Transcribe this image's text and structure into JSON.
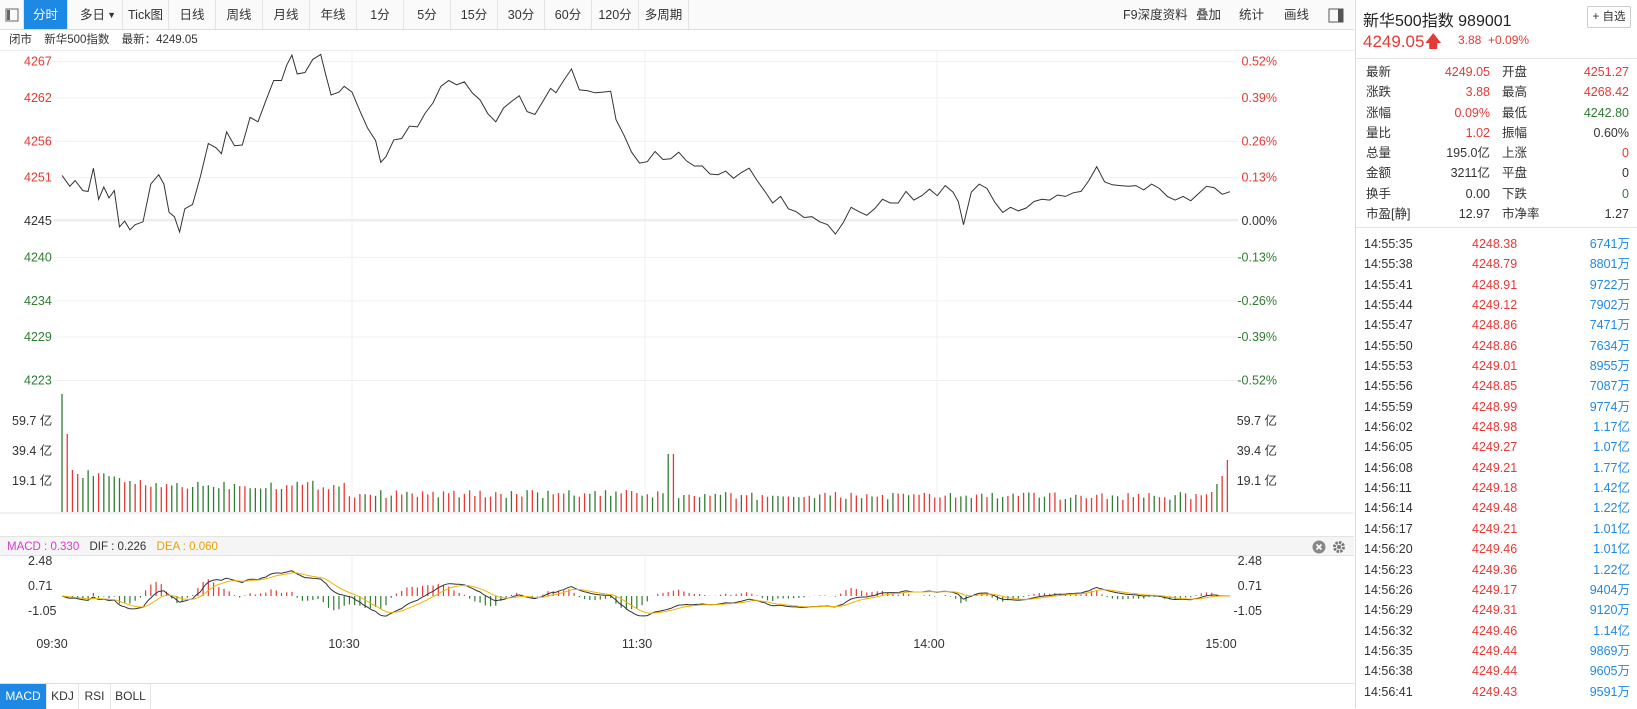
{
  "toolbar": {
    "tabs": [
      "分时",
      "多日",
      "Tick图",
      "日线",
      "周线",
      "月线",
      "年线",
      "1分",
      "5分",
      "15分",
      "30分",
      "60分",
      "120分",
      "多周期"
    ],
    "active_tab": "分时",
    "right_items": [
      "F9深度资料",
      "叠加",
      "统计",
      "画线"
    ]
  },
  "status": {
    "state": "闭市",
    "name": "新华500指数",
    "latest": "最新：4249.05"
  },
  "macd_info": {
    "macd": "MACD : 0.330",
    "dif": "DIF : 0.226",
    "dea": "DEA : 0.060"
  },
  "bottom_tabs": [
    "MACD",
    "KDJ",
    "RSI",
    "BOLL"
  ],
  "sidebar": {
    "title": "新华500指数  989001",
    "add_button": "+ 自选",
    "price": "4249.05",
    "change": "3.88",
    "change_pct": "+0.09%",
    "stats": [
      {
        "l": "最新",
        "v": "4249.05",
        "c": "red",
        "l2": "开盘",
        "v2": "4251.27",
        "c2": "red"
      },
      {
        "l": "涨跌",
        "v": "3.88",
        "c": "red",
        "l2": "最高",
        "v2": "4268.42",
        "c2": "red"
      },
      {
        "l": "涨幅",
        "v": "0.09%",
        "c": "red",
        "l2": "最低",
        "v2": "4242.80",
        "c2": "green"
      },
      {
        "l": "量比",
        "v": "1.02",
        "c": "red",
        "l2": "振幅",
        "v2": "0.60%",
        "c2": "dark"
      },
      {
        "l": "总量",
        "v": "195.0亿",
        "c": "dark",
        "l2": "上涨",
        "v2": "0",
        "c2": "red"
      },
      {
        "l": "金额",
        "v": "3211亿",
        "c": "dark",
        "l2": "平盘",
        "v2": "0",
        "c2": "dark"
      },
      {
        "l": "换手",
        "v": "0.00",
        "c": "dark",
        "l2": "下跌",
        "v2": "0",
        "c2": "green"
      },
      {
        "l": "市盈[静]",
        "v": "12.97",
        "c": "dark",
        "l2": "市净率",
        "v2": "1.27",
        "c2": "dark"
      }
    ],
    "ticks": [
      {
        "t": "14:55:35",
        "p": "4248.38",
        "v": "6741万"
      },
      {
        "t": "14:55:38",
        "p": "4248.79",
        "v": "8801万"
      },
      {
        "t": "14:55:41",
        "p": "4248.91",
        "v": "9722万"
      },
      {
        "t": "14:55:44",
        "p": "4249.12",
        "v": "7902万"
      },
      {
        "t": "14:55:47",
        "p": "4248.86",
        "v": "7471万"
      },
      {
        "t": "14:55:50",
        "p": "4248.86",
        "v": "7634万"
      },
      {
        "t": "14:55:53",
        "p": "4249.01",
        "v": "8955万"
      },
      {
        "t": "14:55:56",
        "p": "4248.85",
        "v": "7087万"
      },
      {
        "t": "14:55:59",
        "p": "4248.99",
        "v": "9774万"
      },
      {
        "t": "14:56:02",
        "p": "4248.98",
        "v": "1.17亿"
      },
      {
        "t": "14:56:05",
        "p": "4249.27",
        "v": "1.07亿"
      },
      {
        "t": "14:56:08",
        "p": "4249.21",
        "v": "1.77亿"
      },
      {
        "t": "14:56:11",
        "p": "4249.18",
        "v": "1.42亿"
      },
      {
        "t": "14:56:14",
        "p": "4249.48",
        "v": "1.22亿"
      },
      {
        "t": "14:56:17",
        "p": "4249.21",
        "v": "1.01亿"
      },
      {
        "t": "14:56:20",
        "p": "4249.46",
        "v": "1.01亿"
      },
      {
        "t": "14:56:23",
        "p": "4249.36",
        "v": "1.22亿"
      },
      {
        "t": "14:56:26",
        "p": "4249.17",
        "v": "9404万"
      },
      {
        "t": "14:56:29",
        "p": "4249.31",
        "v": "9120万"
      },
      {
        "t": "14:56:32",
        "p": "4249.46",
        "v": "1.14亿"
      },
      {
        "t": "14:56:35",
        "p": "4249.44",
        "v": "9869万"
      },
      {
        "t": "14:56:38",
        "p": "4249.44",
        "v": "9605万"
      },
      {
        "t": "14:56:41",
        "p": "4249.43",
        "v": "9591万"
      }
    ]
  },
  "colors": {
    "up": "#e53935",
    "down": "#2e7d32",
    "accent": "#1e88e5",
    "price_line": "#333333",
    "dea_line": "#f0b400"
  },
  "chart_data": {
    "type": "line",
    "prev_close": 4245.17,
    "y_ticks": [
      4267,
      4262,
      4256,
      4251,
      4245,
      4240,
      4234,
      4229,
      4223
    ],
    "y_pct_ticks": [
      "0.52%",
      "0.39%",
      "0.26%",
      "0.13%",
      "0.00%",
      "-0.13%",
      "-0.26%",
      "-0.39%",
      "-0.52%"
    ],
    "x_ticks": [
      "09:30",
      "10:30",
      "11:30",
      "14:00",
      "15:00"
    ],
    "price": [
      [
        0,
        4251.3
      ],
      [
        3,
        4249.8
      ],
      [
        5,
        4250.6
      ],
      [
        8,
        4249.2
      ],
      [
        10,
        4249.1
      ],
      [
        12,
        4252.3
      ],
      [
        14,
        4248.0
      ],
      [
        16,
        4249.7
      ],
      [
        18,
        4248.2
      ],
      [
        20,
        4249.2
      ],
      [
        22,
        4244.2
      ],
      [
        24,
        4245.0
      ],
      [
        26,
        4243.8
      ],
      [
        28,
        4244.5
      ],
      [
        31,
        4244.9
      ],
      [
        34,
        4250.1
      ],
      [
        37,
        4251.4
      ],
      [
        39,
        4250.1
      ],
      [
        41,
        4246.2
      ],
      [
        43,
        4245.6
      ],
      [
        45,
        4243.5
      ],
      [
        47,
        4246.7
      ],
      [
        50,
        4247.3
      ],
      [
        53,
        4251.2
      ],
      [
        56,
        4255.7
      ],
      [
        59,
        4255.1
      ],
      [
        61,
        4254.3
      ],
      [
        63,
        4257.3
      ],
      [
        66,
        4255.4
      ],
      [
        69,
        4255.5
      ],
      [
        72,
        4259.3
      ],
      [
        75,
        4258.7
      ],
      [
        78,
        4261.6
      ],
      [
        81,
        4264.4
      ],
      [
        84,
        4264.4
      ],
      [
        86,
        4266.5
      ],
      [
        88,
        4267.9
      ],
      [
        90,
        4265.3
      ],
      [
        93,
        4265.5
      ],
      [
        96,
        4267.3
      ],
      [
        99,
        4268.0
      ],
      [
        101,
        4265.1
      ],
      [
        103,
        4262.4
      ],
      [
        106,
        4262.8
      ],
      [
        108,
        4263.6
      ],
      [
        111,
        4262.8
      ],
      [
        114,
        4260.2
      ],
      [
        117,
        4257.8
      ],
      [
        120,
        4256.1
      ],
      [
        122,
        4253.1
      ],
      [
        124,
        4253.9
      ],
      [
        127,
        4256.2
      ],
      [
        130,
        4256.4
      ],
      [
        133,
        4258.1
      ],
      [
        136,
        4258.0
      ],
      [
        139,
        4259.9
      ],
      [
        142,
        4261.3
      ],
      [
        145,
        4263.6
      ],
      [
        148,
        4264.4
      ],
      [
        151,
        4263.8
      ],
      [
        154,
        4264.2
      ],
      [
        157,
        4262.7
      ],
      [
        160,
        4261.7
      ],
      [
        163,
        4259.8
      ],
      [
        166,
        4258.7
      ],
      [
        169,
        4260.6
      ],
      [
        172,
        4261.5
      ],
      [
        175,
        4262.3
      ],
      [
        178,
        4260.1
      ],
      [
        181,
        4259.7
      ],
      [
        184,
        4261.5
      ],
      [
        187,
        4263.3
      ],
      [
        189,
        4262.7
      ],
      [
        192,
        4264.4
      ],
      [
        195,
        4266.0
      ],
      [
        198,
        4263.1
      ],
      [
        201,
        4263.0
      ],
      [
        204,
        4262.7
      ],
      [
        207,
        4262.8
      ],
      [
        210,
        4262.9
      ],
      [
        212,
        4259.0
      ],
      [
        215,
        4256.9
      ],
      [
        218,
        4254.5
      ],
      [
        221,
        4253.0
      ],
      [
        224,
        4253.2
      ],
      [
        227,
        4254.6
      ],
      [
        230,
        4253.5
      ],
      [
        233,
        4253.6
      ],
      [
        236,
        4254.5
      ],
      [
        239,
        4253.3
      ],
      [
        242,
        4252.6
      ],
      [
        245,
        4252.6
      ],
      [
        248,
        4251.5
      ],
      [
        251,
        4251.4
      ],
      [
        254,
        4251.9
      ],
      [
        257,
        4250.9
      ],
      [
        260,
        4251.7
      ],
      [
        263,
        4252.3
      ],
      [
        266,
        4250.6
      ],
      [
        269,
        4249.1
      ],
      [
        272,
        4247.5
      ],
      [
        275,
        4248.4
      ],
      [
        278,
        4246.7
      ],
      [
        281,
        4246.3
      ],
      [
        284,
        4245.5
      ],
      [
        287,
        4245.6
      ],
      [
        290,
        4244.9
      ],
      [
        293,
        4244.5
      ],
      [
        296,
        4243.2
      ],
      [
        299,
        4244.8
      ],
      [
        302,
        4246.9
      ],
      [
        305,
        4246.3
      ],
      [
        308,
        4245.8
      ],
      [
        311,
        4246.7
      ],
      [
        314,
        4248.0
      ],
      [
        317,
        4247.5
      ],
      [
        320,
        4247.5
      ],
      [
        323,
        4249.1
      ],
      [
        326,
        4247.9
      ],
      [
        329,
        4248.5
      ],
      [
        332,
        4249.4
      ],
      [
        335,
        4248.5
      ],
      [
        338,
        4249.9
      ],
      [
        341,
        4249.0
      ],
      [
        343,
        4247.7
      ],
      [
        345,
        4244.5
      ],
      [
        348,
        4249.0
      ],
      [
        351,
        4250.1
      ],
      [
        354,
        4249.5
      ],
      [
        357,
        4247.6
      ],
      [
        360,
        4246.2
      ],
      [
        363,
        4246.9
      ],
      [
        366,
        4246.4
      ],
      [
        369,
        4246.8
      ],
      [
        372,
        4247.7
      ],
      [
        375,
        4248.0
      ],
      [
        378,
        4247.9
      ],
      [
        381,
        4248.6
      ],
      [
        384,
        4248.4
      ],
      [
        387,
        4248.9
      ],
      [
        390,
        4249.1
      ],
      [
        393,
        4250.6
      ],
      [
        396,
        4252.5
      ],
      [
        399,
        4250.4
      ],
      [
        402,
        4250.0
      ],
      [
        405,
        4249.9
      ],
      [
        408,
        4249.8
      ],
      [
        411,
        4249.9
      ],
      [
        414,
        4249.3
      ],
      [
        417,
        4250.1
      ],
      [
        420,
        4249.5
      ],
      [
        423,
        4248.4
      ],
      [
        426,
        4247.9
      ],
      [
        429,
        4248.4
      ],
      [
        432,
        4247.8
      ],
      [
        435,
        4248.8
      ],
      [
        438,
        4249.8
      ],
      [
        441,
        4249.6
      ],
      [
        444,
        4248.7
      ],
      [
        447,
        4249.05
      ]
    ],
    "volume_ticks": [
      "59.7 亿",
      "39.4 亿",
      "19.1 亿"
    ],
    "macd_ticks": [
      2.48,
      0.71,
      -1.05
    ]
  }
}
